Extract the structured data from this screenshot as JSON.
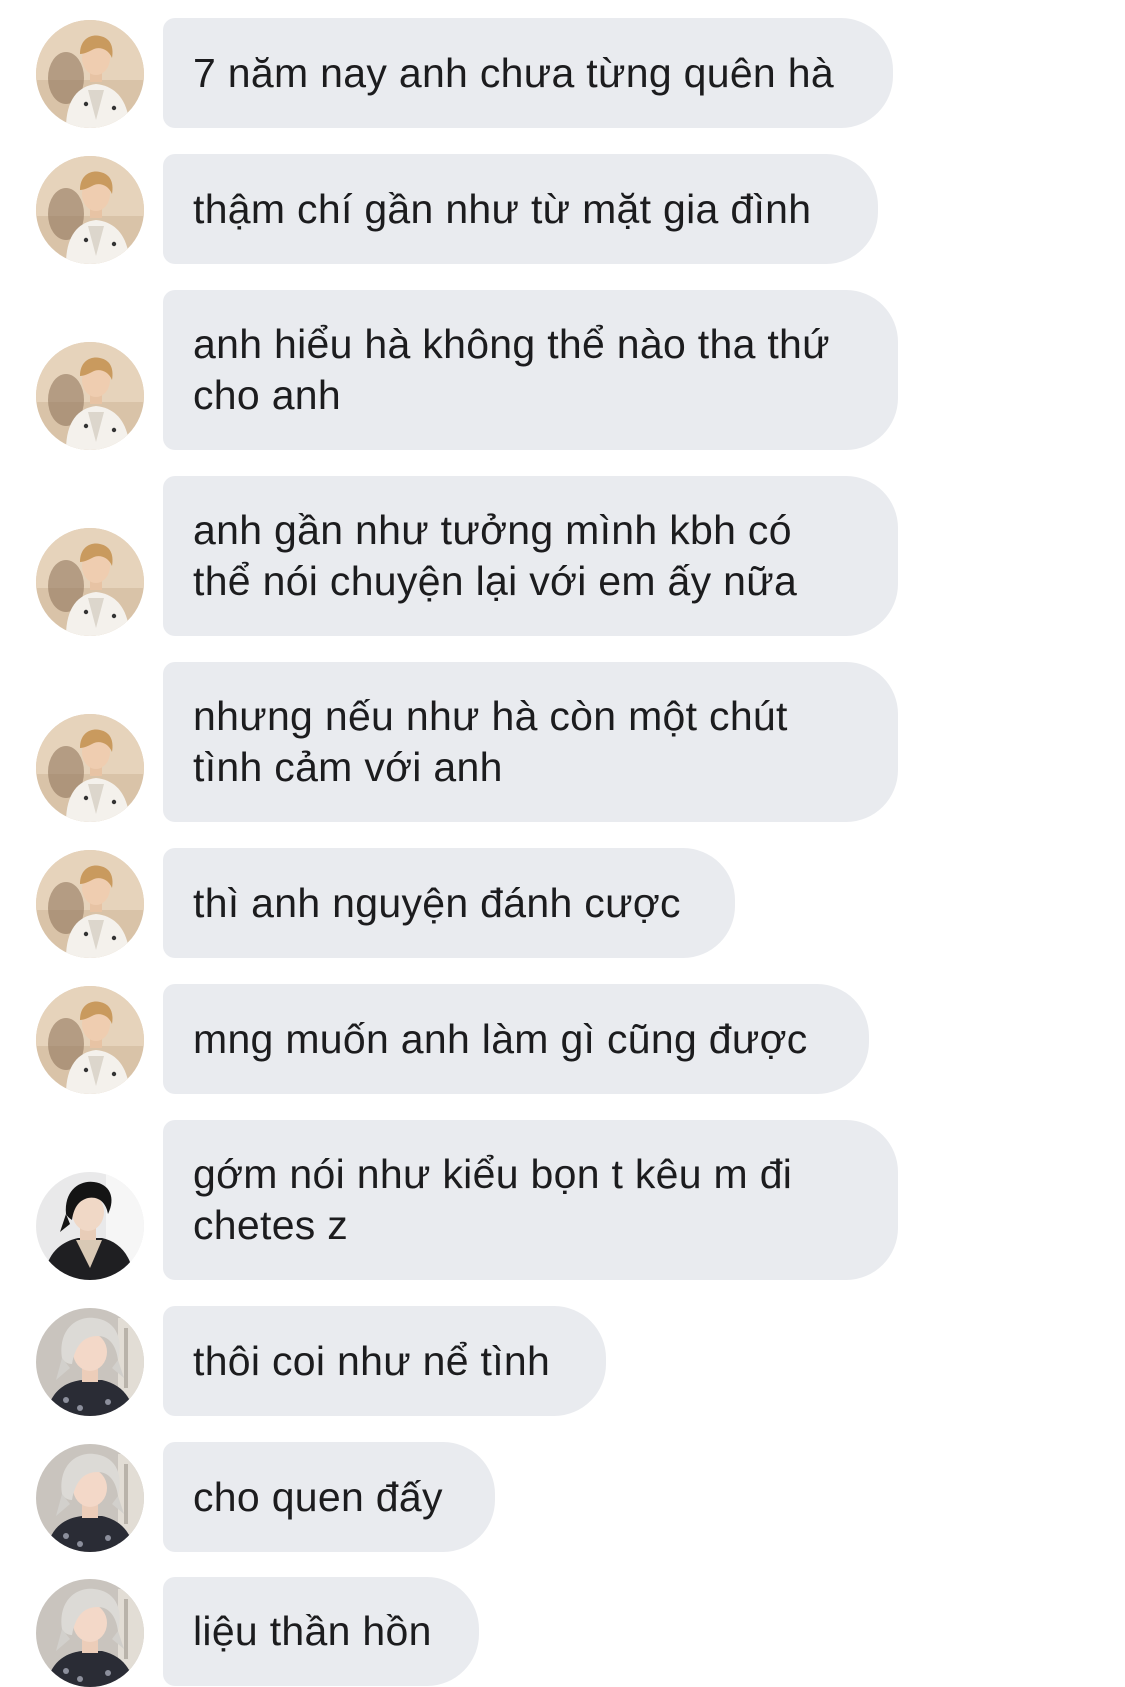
{
  "conversation": {
    "messages": [
      {
        "text": "7 năm nay anh chưa từng quên hà",
        "sender_avatar": "avatar-man-white-shirt"
      },
      {
        "text": "thậm chí gần như từ mặt gia đình",
        "sender_avatar": "avatar-man-white-shirt"
      },
      {
        "text": "anh hiểu hà không thể nào tha thứ\ncho anh",
        "sender_avatar": "avatar-man-white-shirt"
      },
      {
        "text": "anh gần như tưởng mình kbh có\nthể nói chuyện lại với em ấy nữa",
        "sender_avatar": "avatar-man-white-shirt"
      },
      {
        "text": "nhưng nếu như hà còn một chút\ntình cảm với anh",
        "sender_avatar": "avatar-man-white-shirt"
      },
      {
        "text": "thì anh nguyện đánh cược",
        "sender_avatar": "avatar-man-white-shirt"
      },
      {
        "text": "mng muốn anh làm gì cũng được",
        "sender_avatar": "avatar-man-white-shirt"
      },
      {
        "text": "gớm nói như kiểu bọn t kêu m đi\nchetes z",
        "sender_avatar": "avatar-man-dark-hair"
      },
      {
        "text": "thôi coi như nể tình",
        "sender_avatar": "avatar-man-silver-hair"
      },
      {
        "text": "cho quen đấy",
        "sender_avatar": "avatar-man-silver-hair"
      },
      {
        "text": "liệu thần hồn",
        "sender_avatar": "avatar-man-silver-hair"
      }
    ]
  },
  "colors": {
    "bubble_background": "#e9ebef",
    "text": "#1c1c1e",
    "page_background": "#ffffff"
  }
}
